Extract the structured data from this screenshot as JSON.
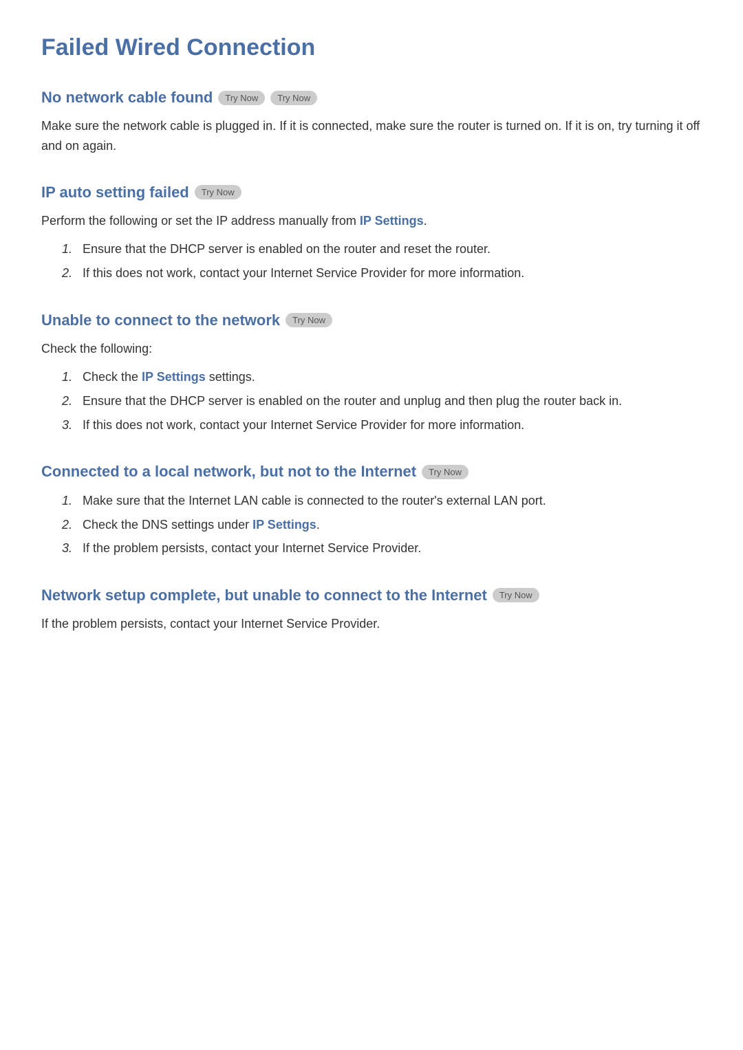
{
  "page": {
    "title": "Failed Wired Connection"
  },
  "sections": [
    {
      "id": "no-cable",
      "title": "No network cable found",
      "buttons": [
        "Try Now",
        "Try Now"
      ],
      "desc": "Make sure the network cable is plugged in. If it is connected, make sure the router is turned on. If it is on, try turning it off and on again.",
      "items": []
    },
    {
      "id": "ip-auto-fail",
      "title": "IP auto setting failed",
      "buttons": [
        "Try Now"
      ],
      "desc": "Perform the following or set the IP address manually from IP Settings.",
      "desc_link": "IP Settings",
      "items": [
        "Ensure that the DHCP server is enabled on the router and reset the router.",
        "If this does not work, contact your Internet Service Provider for more information."
      ]
    },
    {
      "id": "unable-connect",
      "title": "Unable to connect to the network",
      "buttons": [
        "Try Now"
      ],
      "desc": "Check the following:",
      "items": [
        "Check the IP Settings settings.",
        "Ensure that the DHCP server is enabled on the router and unplug and then plug the router back in.",
        "If this does not work, contact your Internet Service Provider for more information."
      ],
      "item_links": [
        0
      ]
    },
    {
      "id": "local-network",
      "title": "Connected to a local network, but not to the Internet",
      "buttons": [
        "Try Now"
      ],
      "desc": "",
      "items": [
        "Make sure that the Internet LAN cable is connected to the router's external LAN port.",
        "Check the DNS settings under IP Settings.",
        "If the problem persists, contact your Internet Service Provider."
      ],
      "item_links": [
        1
      ]
    },
    {
      "id": "setup-complete",
      "title": "Network setup complete, but unable to connect to the Internet",
      "buttons": [
        "Try Now"
      ],
      "desc": "If the problem persists, contact your Internet Service Provider.",
      "items": []
    }
  ],
  "labels": {
    "try_now": "Try Now",
    "ip_settings": "IP Settings"
  }
}
